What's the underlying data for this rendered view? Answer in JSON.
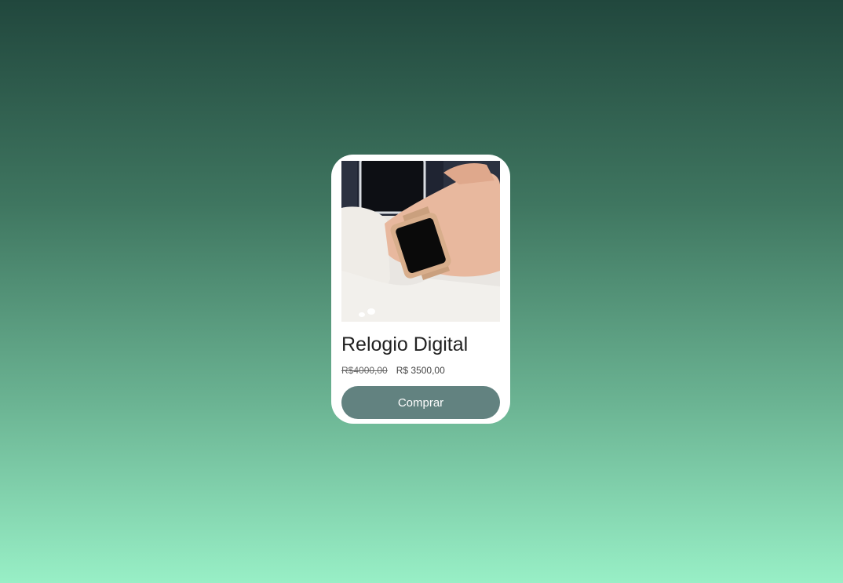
{
  "product": {
    "title": "Relogio Digital",
    "old_price": "R$4000,00",
    "new_price": "R$ 3500,00",
    "buy_label": "Comprar",
    "image_subject": "smartwatch-photo"
  },
  "colors": {
    "background_top": "#21473d",
    "background_bottom": "#98efc6",
    "card": "#ffffff",
    "button": "#628280",
    "button_text": "#ffffff"
  }
}
